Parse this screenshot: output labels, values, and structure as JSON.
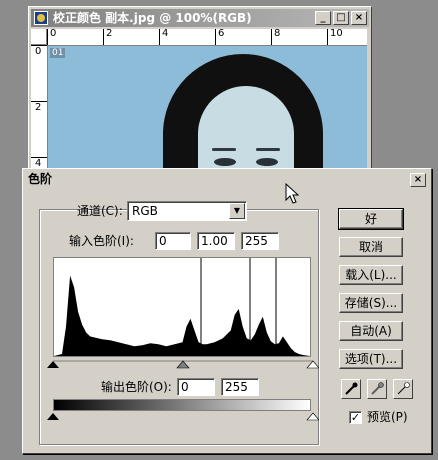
{
  "document": {
    "title": "校正颜色 副本.jpg @ 100%(RGB)",
    "layer_tag": "01",
    "ruler_top": [
      "0",
      "2",
      "4",
      "6",
      "8",
      "10"
    ],
    "ruler_left": [
      "0",
      "2",
      "4"
    ]
  },
  "dialog": {
    "title": "色阶",
    "close_label": "×",
    "channel_label": "通道(C):",
    "channel_value": "RGB",
    "input_levels_label": "输入色阶(I):",
    "input_black": "0",
    "input_gamma": "1.00",
    "input_white": "255",
    "output_levels_label": "输出色阶(O):",
    "output_black": "0",
    "output_white": "255",
    "buttons": {
      "ok": "好",
      "cancel": "取消",
      "load": "载入(L)...",
      "save": "存储(S)...",
      "auto": "自动(A)",
      "options": "选项(T)..."
    },
    "preview_label": "预览(P)",
    "preview_checked": "✓"
  },
  "chart_data": {
    "type": "area",
    "x": [
      0,
      8,
      12,
      16,
      20,
      24,
      28,
      32,
      36,
      40,
      48,
      56,
      64,
      72,
      80,
      88,
      96,
      104,
      112,
      120,
      128,
      132,
      136,
      140,
      144,
      148,
      152,
      160,
      168,
      176,
      180,
      184,
      188,
      192,
      196,
      200,
      204,
      208,
      212,
      216,
      220,
      224,
      228,
      232,
      236,
      240,
      244,
      248,
      255
    ],
    "values": [
      0,
      2,
      30,
      82,
      70,
      45,
      32,
      24,
      20,
      19,
      17,
      16,
      14,
      12,
      10,
      11,
      13,
      12,
      10,
      12,
      14,
      30,
      38,
      26,
      14,
      12,
      12,
      14,
      18,
      26,
      42,
      48,
      30,
      18,
      16,
      22,
      32,
      40,
      24,
      15,
      12,
      13,
      20,
      14,
      8,
      4,
      2,
      1,
      0
    ],
    "xlim": [
      0,
      255
    ],
    "ylim": [
      0,
      100
    ]
  }
}
